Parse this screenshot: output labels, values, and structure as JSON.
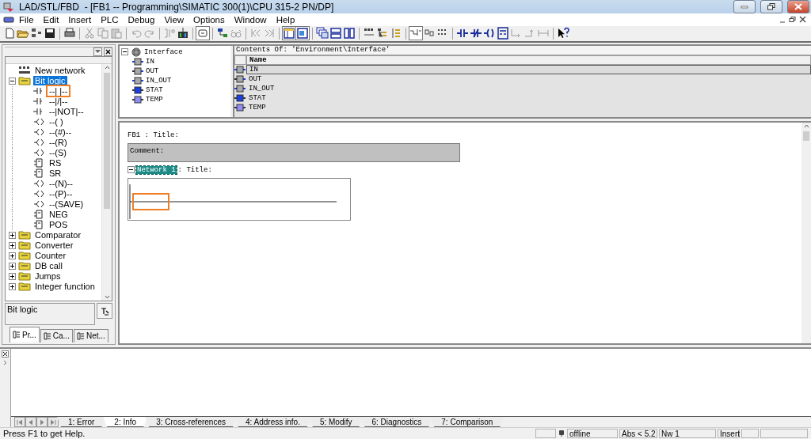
{
  "window": {
    "title": "LAD/STL/FBD  - [FB1 -- Programming\\SIMATIC 300(1)\\CPU 315-2 PN/DP]"
  },
  "menu": [
    "File",
    "Edit",
    "Insert",
    "PLC",
    "Debug",
    "View",
    "Options",
    "Window",
    "Help"
  ],
  "catalog": {
    "items": [
      {
        "label": "New network",
        "kind": "network",
        "selected": false
      },
      {
        "label": "Bit logic",
        "kind": "folder",
        "expanded": true,
        "selected": true,
        "children": [
          {
            "label": "--| |--",
            "kind": "contact",
            "selected": false,
            "highlighted": true
          },
          {
            "label": "--|/|--",
            "kind": "contact",
            "selected": false,
            "highlighted": false
          },
          {
            "label": "--|NOT|--",
            "kind": "contact",
            "selected": false,
            "highlighted": false
          },
          {
            "label": "--( )",
            "kind": "coil",
            "selected": false,
            "highlighted": false
          },
          {
            "label": "--(#)--",
            "kind": "coil",
            "selected": false,
            "highlighted": false
          },
          {
            "label": "--(R)",
            "kind": "coil",
            "selected": false,
            "highlighted": false
          },
          {
            "label": "--(S)",
            "kind": "coil",
            "selected": false,
            "highlighted": false
          },
          {
            "label": "RS",
            "kind": "box",
            "selected": false,
            "highlighted": false
          },
          {
            "label": "SR",
            "kind": "box",
            "selected": false,
            "highlighted": false
          },
          {
            "label": "--(N)--",
            "kind": "coil",
            "selected": false,
            "highlighted": false
          },
          {
            "label": "--(P)--",
            "kind": "coil",
            "selected": false,
            "highlighted": false
          },
          {
            "label": "--(SAVE)",
            "kind": "coil",
            "selected": false,
            "highlighted": false
          },
          {
            "label": "NEG",
            "kind": "box",
            "selected": false,
            "highlighted": false
          },
          {
            "label": "POS",
            "kind": "box",
            "selected": false,
            "highlighted": false
          }
        ]
      },
      {
        "label": "Comparator",
        "kind": "folder",
        "expanded": false,
        "selected": false
      },
      {
        "label": "Converter",
        "kind": "folder",
        "expanded": false,
        "selected": false
      },
      {
        "label": "Counter",
        "kind": "folder",
        "expanded": false,
        "selected": false
      },
      {
        "label": "DB call",
        "kind": "folder",
        "expanded": false,
        "selected": false
      },
      {
        "label": "Jumps",
        "kind": "folder",
        "expanded": false,
        "selected": false
      },
      {
        "label": "Integer function",
        "kind": "folder",
        "expanded": false,
        "selected": false
      }
    ],
    "description": "Bit logic",
    "tabs": [
      {
        "label": "Pr...",
        "selected": true
      },
      {
        "label": "Ca...",
        "selected": false
      },
      {
        "label": "Net...",
        "selected": false
      }
    ]
  },
  "interface": {
    "tree": {
      "label": "Interface",
      "expanded": true,
      "children": [
        {
          "label": "IN",
          "kind": "in"
        },
        {
          "label": "OUT",
          "kind": "out"
        },
        {
          "label": "IN_OUT",
          "kind": "in_out"
        },
        {
          "label": "STAT",
          "kind": "stat"
        },
        {
          "label": "TEMP",
          "kind": "temp"
        }
      ]
    },
    "contents_title": "Contents Of: 'Environment\\Interface'",
    "column": "Name",
    "rows": [
      {
        "name": "IN",
        "kind": "in",
        "selected": true
      },
      {
        "name": "OUT",
        "kind": "out",
        "selected": false
      },
      {
        "name": "IN_OUT",
        "kind": "in_out",
        "selected": false
      },
      {
        "name": "STAT",
        "kind": "stat",
        "selected": false
      },
      {
        "name": "TEMP",
        "kind": "temp",
        "selected": false
      }
    ]
  },
  "editor": {
    "block_title": "FB1 : Title:",
    "comment_label": "Comment:",
    "network": {
      "label": "Network 1",
      "title": ": Title:",
      "expanded": true,
      "highlighted": true
    }
  },
  "output": {
    "tabs": [
      {
        "label": "1: Error",
        "selected": false
      },
      {
        "label": "2: Info",
        "selected": true
      },
      {
        "label": "3: Cross-references",
        "selected": false
      },
      {
        "label": "4: Address info.",
        "selected": false
      },
      {
        "label": "5: Modify",
        "selected": false
      },
      {
        "label": "6: Diagnostics",
        "selected": false
      },
      {
        "label": "7: Comparison",
        "selected": false
      }
    ]
  },
  "status_bar": {
    "help": "Press F1 to get Help.",
    "mode": "offline",
    "position": "Abs < 5.2",
    "network": "Nw 1",
    "insert": "Insert"
  }
}
